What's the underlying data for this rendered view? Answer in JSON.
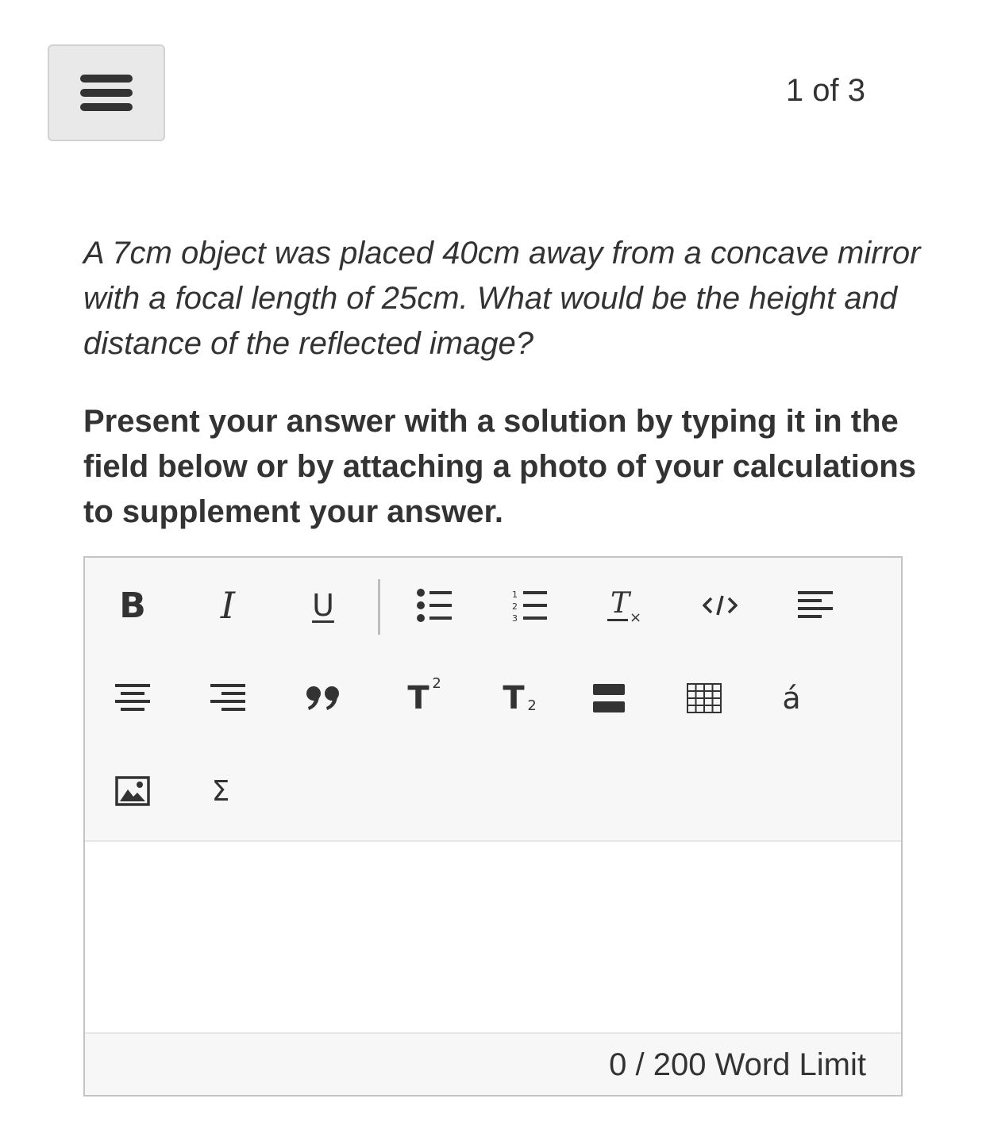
{
  "header": {
    "menu_icon": "hamburger-menu-icon",
    "page_counter": "1 of 3"
  },
  "question": {
    "text": "A 7cm object was placed 40cm away from a concave mirror with a focal length of 25cm. What would be the height and distance of the reflected image?",
    "instruction": "Present your answer with a solution by typing it in the field below or by attaching a photo of your calculations to supplement your answer."
  },
  "editor": {
    "toolbar": {
      "bold_label": "B",
      "italic_label": "I",
      "underline_label": "U",
      "clear_format_label": "T",
      "superscript_label": "T",
      "subscript_label": "T",
      "special_char_label": "á",
      "formula_label": "Σ",
      "icons": [
        "bold-icon",
        "italic-icon",
        "underline-icon",
        "bullet-list-icon",
        "numbered-list-icon",
        "clear-formatting-icon",
        "code-icon",
        "align-left-icon",
        "align-center-icon",
        "align-right-icon",
        "blockquote-icon",
        "superscript-icon",
        "subscript-icon",
        "horizontal-rule-icon",
        "table-icon",
        "special-character-icon",
        "image-icon",
        "formula-icon"
      ]
    },
    "answer_value": "",
    "word_count": "0",
    "word_limit_text": " / 200 Word Limit"
  }
}
